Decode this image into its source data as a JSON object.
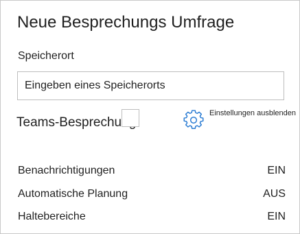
{
  "panel": {
    "title": "Neue Besprechungs Umfrage"
  },
  "location": {
    "label": "Speicherort",
    "placeholder": "Eingeben eines Speicherorts",
    "value": ""
  },
  "teams": {
    "label": "Teams-Besprechung",
    "checked": false
  },
  "settings_link": {
    "icon": "gear-icon",
    "label": "Einstellungen ausblenden",
    "accent_color": "#2b7cd3"
  },
  "settings": [
    {
      "label": "Benachrichtigungen",
      "value": "EIN"
    },
    {
      "label": "Automatische Planung",
      "value": "AUS"
    },
    {
      "label": "Haltebereiche",
      "value": "EIN"
    }
  ]
}
